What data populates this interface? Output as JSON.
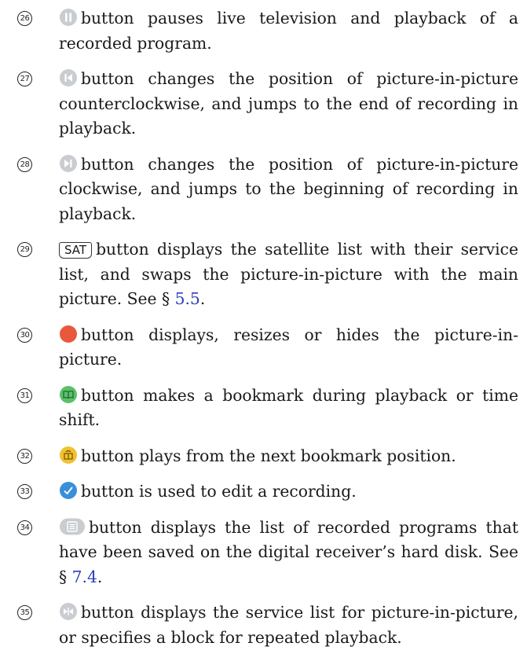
{
  "items": [
    {
      "num": "26",
      "icon": "pause-icon",
      "text": "button pauses live television and playback of a recorded program."
    },
    {
      "num": "27",
      "icon": "skip-back-icon",
      "text": "button changes the position of picture-in-picture counterclockwise, and jumps to the end of recording in playback."
    },
    {
      "num": "28",
      "icon": "skip-forward-icon",
      "text": "button changes the position of picture-in-picture clockwise, and jumps to the beginning of recording in playback."
    },
    {
      "num": "29",
      "icon": "sat-button",
      "label": "SAT",
      "text": "button displays the satellite list with their service list, and swaps the picture-in-picture with the main picture. See §",
      "link": "5.5",
      "after": "."
    },
    {
      "num": "30",
      "icon": "red-button-icon",
      "color": "#e8583c",
      "text": "button displays, resizes or hides the picture-in-picture."
    },
    {
      "num": "31",
      "icon": "green-bookmark-icon",
      "color": "#5bc06a",
      "text": "button makes a bookmark during playback or time shift."
    },
    {
      "num": "32",
      "icon": "yellow-bookmark-jump-icon",
      "color": "#f2c12e",
      "text": "button plays from the next bookmark position."
    },
    {
      "num": "33",
      "icon": "blue-check-icon",
      "color": "#3a8fd9",
      "text": "button is used to edit a recording."
    },
    {
      "num": "34",
      "icon": "recordings-list-icon",
      "text": "button displays the list of recorded programs that have been saved on the digital receiver’s hard disk. See §",
      "link": "7.4",
      "after": "."
    },
    {
      "num": "35",
      "icon": "pip-list-icon",
      "text": "button displays the service list for picture-in-picture, or specifies a block for repeated playback."
    }
  ]
}
